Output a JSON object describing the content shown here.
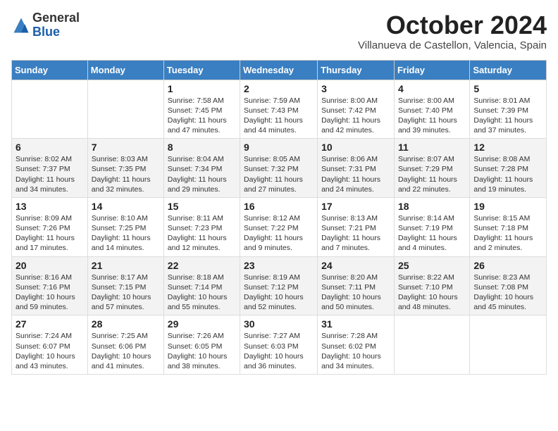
{
  "header": {
    "logo": {
      "general": "General",
      "blue": "Blue"
    },
    "title": "October 2024",
    "subtitle": "Villanueva de Castellon, Valencia, Spain"
  },
  "columns": [
    "Sunday",
    "Monday",
    "Tuesday",
    "Wednesday",
    "Thursday",
    "Friday",
    "Saturday"
  ],
  "weeks": [
    [
      {
        "day": "",
        "sunrise": "",
        "sunset": "",
        "daylight": ""
      },
      {
        "day": "",
        "sunrise": "",
        "sunset": "",
        "daylight": ""
      },
      {
        "day": "1",
        "sunrise": "Sunrise: 7:58 AM",
        "sunset": "Sunset: 7:45 PM",
        "daylight": "Daylight: 11 hours and 47 minutes."
      },
      {
        "day": "2",
        "sunrise": "Sunrise: 7:59 AM",
        "sunset": "Sunset: 7:43 PM",
        "daylight": "Daylight: 11 hours and 44 minutes."
      },
      {
        "day": "3",
        "sunrise": "Sunrise: 8:00 AM",
        "sunset": "Sunset: 7:42 PM",
        "daylight": "Daylight: 11 hours and 42 minutes."
      },
      {
        "day": "4",
        "sunrise": "Sunrise: 8:00 AM",
        "sunset": "Sunset: 7:40 PM",
        "daylight": "Daylight: 11 hours and 39 minutes."
      },
      {
        "day": "5",
        "sunrise": "Sunrise: 8:01 AM",
        "sunset": "Sunset: 7:39 PM",
        "daylight": "Daylight: 11 hours and 37 minutes."
      }
    ],
    [
      {
        "day": "6",
        "sunrise": "Sunrise: 8:02 AM",
        "sunset": "Sunset: 7:37 PM",
        "daylight": "Daylight: 11 hours and 34 minutes."
      },
      {
        "day": "7",
        "sunrise": "Sunrise: 8:03 AM",
        "sunset": "Sunset: 7:35 PM",
        "daylight": "Daylight: 11 hours and 32 minutes."
      },
      {
        "day": "8",
        "sunrise": "Sunrise: 8:04 AM",
        "sunset": "Sunset: 7:34 PM",
        "daylight": "Daylight: 11 hours and 29 minutes."
      },
      {
        "day": "9",
        "sunrise": "Sunrise: 8:05 AM",
        "sunset": "Sunset: 7:32 PM",
        "daylight": "Daylight: 11 hours and 27 minutes."
      },
      {
        "day": "10",
        "sunrise": "Sunrise: 8:06 AM",
        "sunset": "Sunset: 7:31 PM",
        "daylight": "Daylight: 11 hours and 24 minutes."
      },
      {
        "day": "11",
        "sunrise": "Sunrise: 8:07 AM",
        "sunset": "Sunset: 7:29 PM",
        "daylight": "Daylight: 11 hours and 22 minutes."
      },
      {
        "day": "12",
        "sunrise": "Sunrise: 8:08 AM",
        "sunset": "Sunset: 7:28 PM",
        "daylight": "Daylight: 11 hours and 19 minutes."
      }
    ],
    [
      {
        "day": "13",
        "sunrise": "Sunrise: 8:09 AM",
        "sunset": "Sunset: 7:26 PM",
        "daylight": "Daylight: 11 hours and 17 minutes."
      },
      {
        "day": "14",
        "sunrise": "Sunrise: 8:10 AM",
        "sunset": "Sunset: 7:25 PM",
        "daylight": "Daylight: 11 hours and 14 minutes."
      },
      {
        "day": "15",
        "sunrise": "Sunrise: 8:11 AM",
        "sunset": "Sunset: 7:23 PM",
        "daylight": "Daylight: 11 hours and 12 minutes."
      },
      {
        "day": "16",
        "sunrise": "Sunrise: 8:12 AM",
        "sunset": "Sunset: 7:22 PM",
        "daylight": "Daylight: 11 hours and 9 minutes."
      },
      {
        "day": "17",
        "sunrise": "Sunrise: 8:13 AM",
        "sunset": "Sunset: 7:21 PM",
        "daylight": "Daylight: 11 hours and 7 minutes."
      },
      {
        "day": "18",
        "sunrise": "Sunrise: 8:14 AM",
        "sunset": "Sunset: 7:19 PM",
        "daylight": "Daylight: 11 hours and 4 minutes."
      },
      {
        "day": "19",
        "sunrise": "Sunrise: 8:15 AM",
        "sunset": "Sunset: 7:18 PM",
        "daylight": "Daylight: 11 hours and 2 minutes."
      }
    ],
    [
      {
        "day": "20",
        "sunrise": "Sunrise: 8:16 AM",
        "sunset": "Sunset: 7:16 PM",
        "daylight": "Daylight: 10 hours and 59 minutes."
      },
      {
        "day": "21",
        "sunrise": "Sunrise: 8:17 AM",
        "sunset": "Sunset: 7:15 PM",
        "daylight": "Daylight: 10 hours and 57 minutes."
      },
      {
        "day": "22",
        "sunrise": "Sunrise: 8:18 AM",
        "sunset": "Sunset: 7:14 PM",
        "daylight": "Daylight: 10 hours and 55 minutes."
      },
      {
        "day": "23",
        "sunrise": "Sunrise: 8:19 AM",
        "sunset": "Sunset: 7:12 PM",
        "daylight": "Daylight: 10 hours and 52 minutes."
      },
      {
        "day": "24",
        "sunrise": "Sunrise: 8:20 AM",
        "sunset": "Sunset: 7:11 PM",
        "daylight": "Daylight: 10 hours and 50 minutes."
      },
      {
        "day": "25",
        "sunrise": "Sunrise: 8:22 AM",
        "sunset": "Sunset: 7:10 PM",
        "daylight": "Daylight: 10 hours and 48 minutes."
      },
      {
        "day": "26",
        "sunrise": "Sunrise: 8:23 AM",
        "sunset": "Sunset: 7:08 PM",
        "daylight": "Daylight: 10 hours and 45 minutes."
      }
    ],
    [
      {
        "day": "27",
        "sunrise": "Sunrise: 7:24 AM",
        "sunset": "Sunset: 6:07 PM",
        "daylight": "Daylight: 10 hours and 43 minutes."
      },
      {
        "day": "28",
        "sunrise": "Sunrise: 7:25 AM",
        "sunset": "Sunset: 6:06 PM",
        "daylight": "Daylight: 10 hours and 41 minutes."
      },
      {
        "day": "29",
        "sunrise": "Sunrise: 7:26 AM",
        "sunset": "Sunset: 6:05 PM",
        "daylight": "Daylight: 10 hours and 38 minutes."
      },
      {
        "day": "30",
        "sunrise": "Sunrise: 7:27 AM",
        "sunset": "Sunset: 6:03 PM",
        "daylight": "Daylight: 10 hours and 36 minutes."
      },
      {
        "day": "31",
        "sunrise": "Sunrise: 7:28 AM",
        "sunset": "Sunset: 6:02 PM",
        "daylight": "Daylight: 10 hours and 34 minutes."
      },
      {
        "day": "",
        "sunrise": "",
        "sunset": "",
        "daylight": ""
      },
      {
        "day": "",
        "sunrise": "",
        "sunset": "",
        "daylight": ""
      }
    ]
  ]
}
